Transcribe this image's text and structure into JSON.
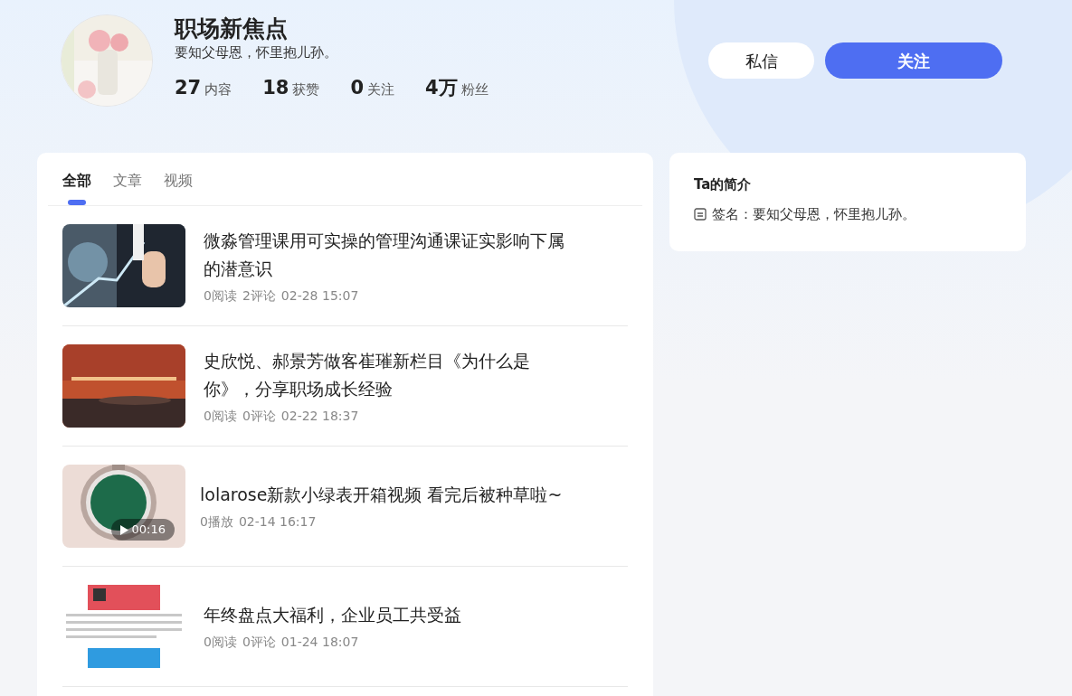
{
  "profile": {
    "name": "职场新焦点",
    "bio": "要知父母恩，怀里抱儿孙。",
    "stats": [
      {
        "value": "27",
        "label": "内容"
      },
      {
        "value": "18",
        "label": "获赞"
      },
      {
        "value": "0",
        "label": "关注"
      },
      {
        "value": "4万",
        "label": "粉丝"
      }
    ],
    "buttons": [
      {
        "label": "私信",
        "kind": "secondary"
      },
      {
        "label": "关注",
        "kind": "primary"
      }
    ]
  },
  "tabs": [
    {
      "label": "全部",
      "selected": true
    },
    {
      "label": "文章",
      "selected": false
    },
    {
      "label": "视频",
      "selected": false
    }
  ],
  "feed": [
    {
      "kind": "article",
      "title": "微淼管理课用可实操的管理沟通课证实影响下属的潜意识",
      "meta": [
        "0阅读",
        "2评论",
        "02-28 15:07"
      ]
    },
    {
      "kind": "article",
      "title": "史欣悦、郝景芳做客崔璀新栏目《为什么是你》，分享职场成长经验",
      "meta": [
        "0阅读",
        "0评论",
        "02-22 18:37"
      ]
    },
    {
      "kind": "video",
      "title": "lolarose新款小绿表开箱视频 看完后被种草啦~",
      "duration": "00:16",
      "meta": [
        "0播放",
        "02-14 16:17"
      ]
    },
    {
      "kind": "article",
      "title": "年终盘点大福利，企业员工共受益",
      "meta": [
        "0阅读",
        "0评论",
        "01-24 18:07"
      ]
    }
  ],
  "intro": {
    "title": "Ta的简介",
    "signature": "签名：要知父母恩，怀里抱儿孙。"
  }
}
